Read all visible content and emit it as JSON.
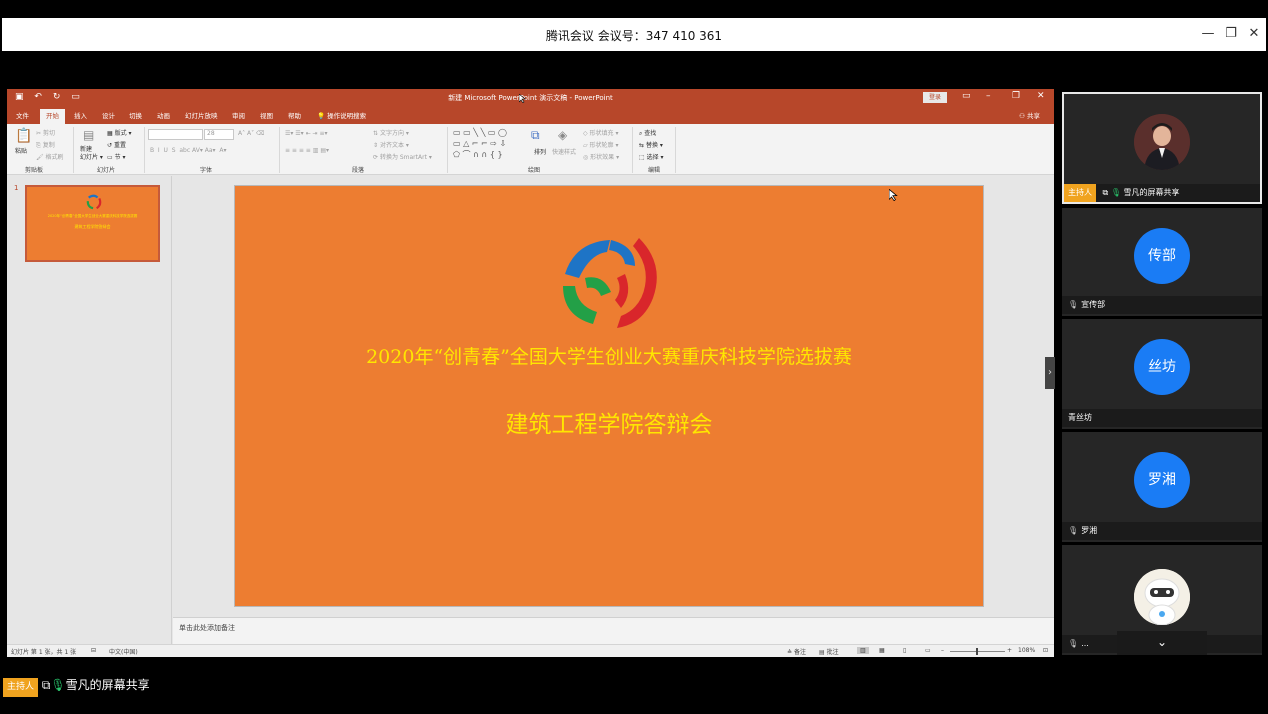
{
  "meeting": {
    "title": "腾讯会议 会议号：347 410 361",
    "minimize": "—",
    "restore": "❐",
    "close": "✕"
  },
  "ppt": {
    "doc_title": "新建 Microsoft PowerPoint 演示文稿 - PowerPoint",
    "login": "登录",
    "share": "共享",
    "tabs": [
      "文件",
      "开始",
      "插入",
      "设计",
      "切换",
      "动画",
      "幻灯片放映",
      "审阅",
      "视图",
      "帮助",
      "操作说明搜索"
    ],
    "ribbon": {
      "clipboard": {
        "label": "剪贴板",
        "paste": "粘贴",
        "cut": "剪切",
        "copy": "复制",
        "format_painter": "格式刷"
      },
      "slides": {
        "label": "幻灯片",
        "new_slide": "新建\n幻灯片",
        "layout": "版式",
        "reset": "重置",
        "section": "节"
      },
      "font": {
        "label": "字体",
        "size": "28"
      },
      "paragraph": {
        "label": "段落",
        "text_direction": "文字方向",
        "align_text": "对齐文本",
        "smartart": "转换为 SmartArt"
      },
      "drawing": {
        "label": "绘图",
        "arrange": "排列",
        "quick_styles": "快速样式",
        "shape_fill": "形状填充",
        "shape_outline": "形状轮廓",
        "shape_effects": "形状效果"
      },
      "editing": {
        "label": "编辑",
        "find": "查找",
        "replace": "替换",
        "select": "选择"
      }
    },
    "slide_number": "1",
    "thumb": {
      "line1": "2020年“创青春”全国大学生创业大赛重庆科技学院选拔赛",
      "line2": "建筑工程学院答辩会"
    },
    "slide": {
      "line1": "2020年“创青春”全国大学生创业大赛重庆科技学院选拔赛",
      "line2": "建筑工程学院答辩会"
    },
    "notes_placeholder": "单击此处添加备注",
    "status": {
      "slide_info": "幻灯片 第 1 张，共 1 张",
      "language": "中文(中国)",
      "notes": "备注",
      "comments": "批注",
      "zoom": "108%"
    }
  },
  "participants": [
    {
      "name": "雪凡的屏幕共享",
      "host_tag": "主持人",
      "type": "photo"
    },
    {
      "name": "宣传部",
      "avatar_text": "传部",
      "color": "#1a7cf5"
    },
    {
      "name": "青丝坊",
      "avatar_text": "丝坊",
      "color": "#1a7cf5"
    },
    {
      "name": "罗湘",
      "avatar_text": "罗湘",
      "color": "#1a7cf5"
    },
    {
      "name": "...",
      "type": "robot"
    }
  ],
  "bottom_bar": {
    "host_tag": "主持人",
    "name": "雪凡的屏幕共享"
  }
}
